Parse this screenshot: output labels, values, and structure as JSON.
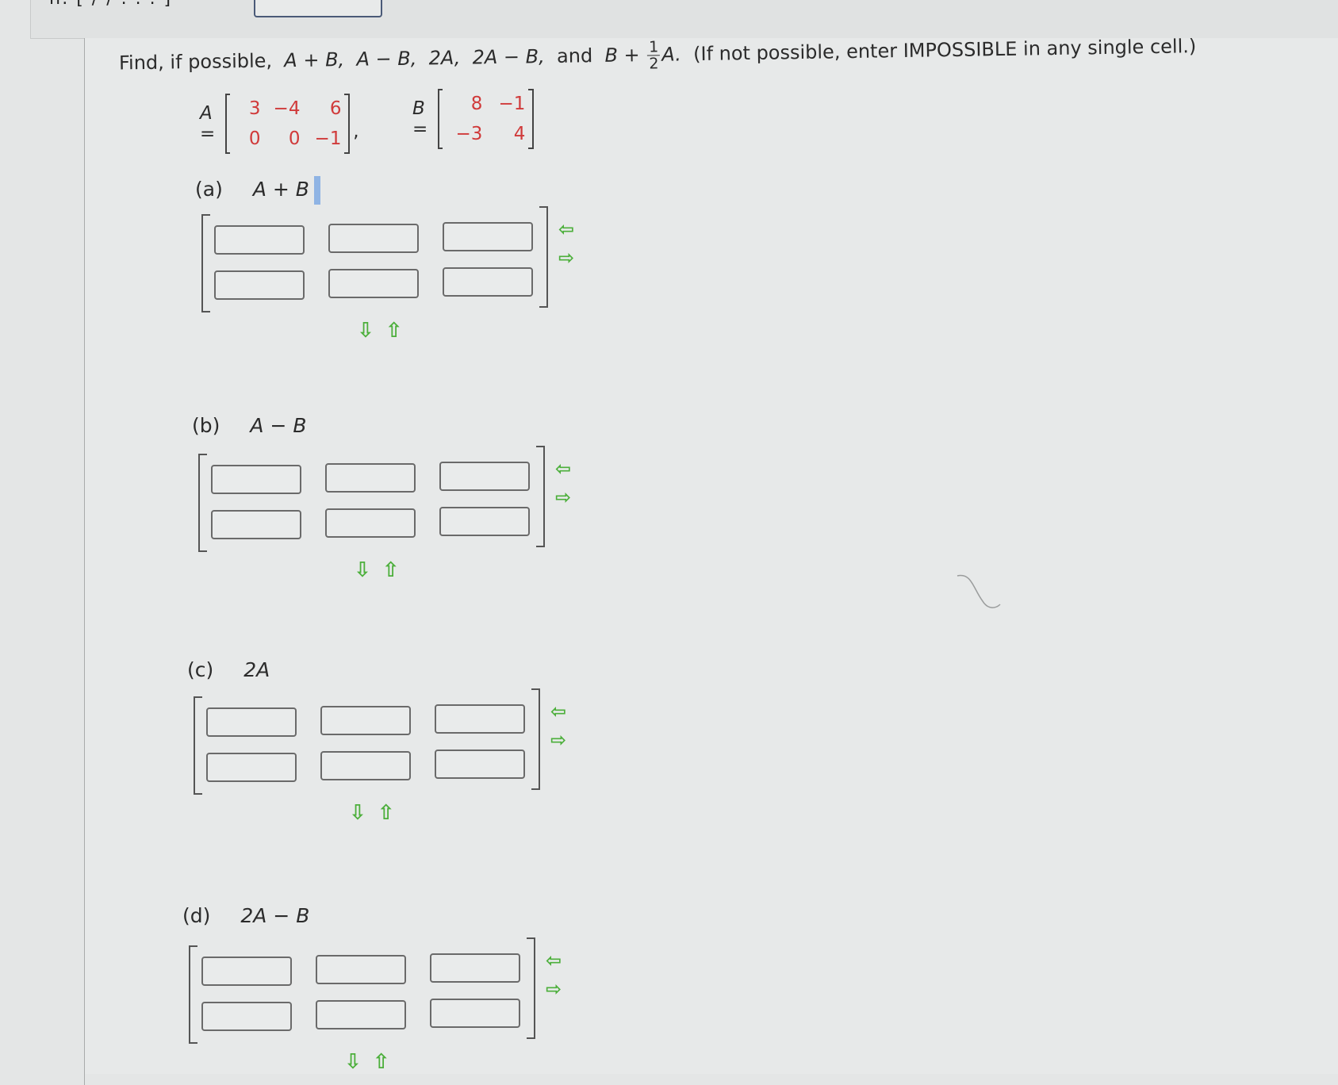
{
  "top": {
    "partial_text": "ii. [ / / . . . ]"
  },
  "prompt": {
    "prefix": "Find, if possible,",
    "expr1": "A + B,",
    "expr2": "A − B,",
    "expr3": "2A,",
    "expr4": "2A − B,",
    "and": "and",
    "expr5_pre": "B +",
    "frac_num": "1",
    "frac_den": "2",
    "expr5_post": "A.",
    "note": "(If not possible, enter IMPOSSIBLE in any single cell.)"
  },
  "matrices": {
    "A": {
      "name": "A =",
      "rows": [
        [
          "3",
          "−4",
          "6"
        ],
        [
          "0",
          "0",
          "−1"
        ]
      ]
    },
    "B": {
      "name": "B =",
      "rows": [
        [
          "8",
          "−1"
        ],
        [
          "−3",
          "4"
        ]
      ]
    },
    "comma": ","
  },
  "parts": [
    {
      "id": "a",
      "label": "(a)",
      "expr": "A + B",
      "rows": 2,
      "cols": 3,
      "values": [
        [
          "",
          "",
          ""
        ],
        [
          "",
          "",
          ""
        ]
      ]
    },
    {
      "id": "b",
      "label": "(b)",
      "expr": "A − B",
      "rows": 2,
      "cols": 3,
      "values": [
        [
          "",
          "",
          ""
        ],
        [
          "",
          "",
          ""
        ]
      ]
    },
    {
      "id": "c",
      "label": "(c)",
      "expr": "2A",
      "rows": 2,
      "cols": 3,
      "values": [
        [
          "",
          "",
          ""
        ],
        [
          "",
          "",
          ""
        ]
      ]
    },
    {
      "id": "d",
      "label": "(d)",
      "expr": "2A − B",
      "rows": 2,
      "cols": 3,
      "values": [
        [
          "",
          "",
          ""
        ],
        [
          "",
          "",
          ""
        ]
      ]
    }
  ],
  "icons": {
    "remove_column": "⇦",
    "add_column": "⇨",
    "add_row": "⇩",
    "remove_row": "⇧"
  },
  "colors": {
    "entry_red": "#d03a3a",
    "arrow_green": "#4caf3b",
    "cursor_blue": "#8fb4e4"
  }
}
